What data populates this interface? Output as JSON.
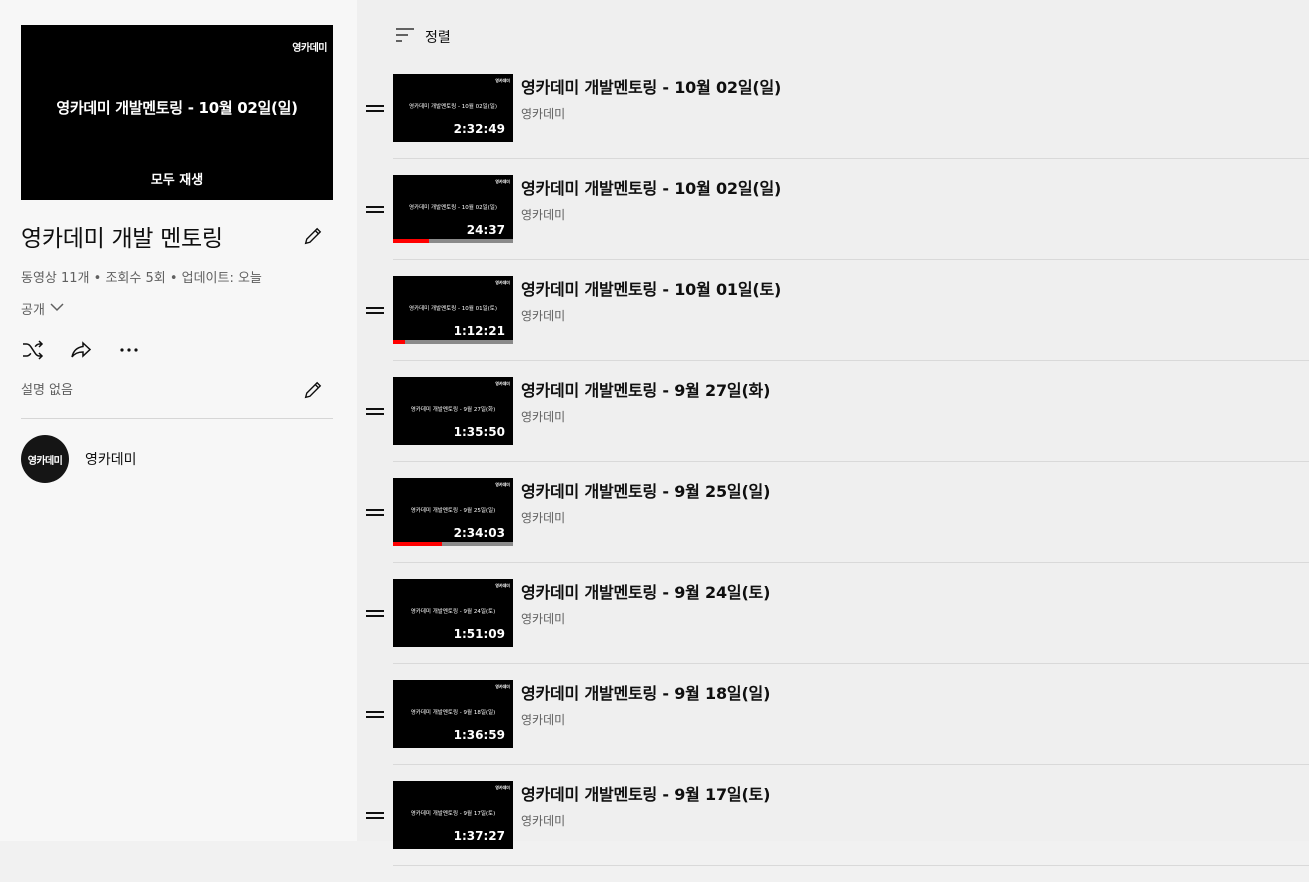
{
  "playlist": {
    "hero_logo": "영카데미",
    "hero_title": "영카데미 개발멘토링 - 10월 02일(일)",
    "play_all": "모두 재생",
    "title": "영카데미 개발 멘토링",
    "stats": "동영상 11개 • 조회수 5회 • 업데이트: 오늘",
    "privacy": "공개",
    "description": "설명 없음",
    "owner_avatar_text": "영카데미",
    "owner_name": "영카데미"
  },
  "icons": {
    "edit": "pencil-icon",
    "shuffle": "shuffle-icon",
    "share": "share-icon",
    "more": "more-horizontal-icon",
    "sort": "sort-icon",
    "privacy": "chevron-down-icon",
    "drag": "drag-handle-icon"
  },
  "colors": {
    "progress": "#ff0000",
    "sidebar_bg": "#f7f7f7",
    "list_bg": "#efefef"
  },
  "sort_label": "정렬",
  "videos": [
    {
      "title": "영카데미 개발멘토링 - 10월 02일(일)",
      "thumb_title": "영카데미 개발멘토링 - 10월 02일(일)",
      "duration": "2:32:49",
      "channel": "영카데미",
      "progress": 0
    },
    {
      "title": "영카데미 개발멘토링 - 10월 02일(일)",
      "thumb_title": "영카데미 개발멘토링 - 10월 02일(일)",
      "duration": "24:37",
      "channel": "영카데미",
      "progress": 0.3
    },
    {
      "title": "영카데미 개발멘토링 - 10월 01일(토)",
      "thumb_title": "영카데미 개발멘토링 - 10월 01일(토)",
      "duration": "1:12:21",
      "channel": "영카데미",
      "progress": 0.1
    },
    {
      "title": "영카데미 개발멘토링 - 9월 27일(화)",
      "thumb_title": "영카데미 개발멘토링 - 9월 27일(화)",
      "duration": "1:35:50",
      "channel": "영카데미",
      "progress": 0
    },
    {
      "title": "영카데미 개발멘토링 - 9월 25일(일)",
      "thumb_title": "영카데미 개발멘토링 - 9월 25일(일)",
      "duration": "2:34:03",
      "channel": "영카데미",
      "progress": 0.41
    },
    {
      "title": "영카데미 개발멘토링 - 9월 24일(토)",
      "thumb_title": "영카데미 개발멘토링 - 9월 24일(토)",
      "duration": "1:51:09",
      "channel": "영카데미",
      "progress": 0
    },
    {
      "title": "영카데미 개발멘토링 - 9월 18일(일)",
      "thumb_title": "영카데미 개발멘토링 - 9월 18일(일)",
      "duration": "1:36:59",
      "channel": "영카데미",
      "progress": 0
    },
    {
      "title": "영카데미 개발멘토링 - 9월 17일(토)",
      "thumb_title": "영카데미 개발멘토링 - 9월 17일(토)",
      "duration": "1:37:27",
      "channel": "영카데미",
      "progress": 0
    }
  ]
}
